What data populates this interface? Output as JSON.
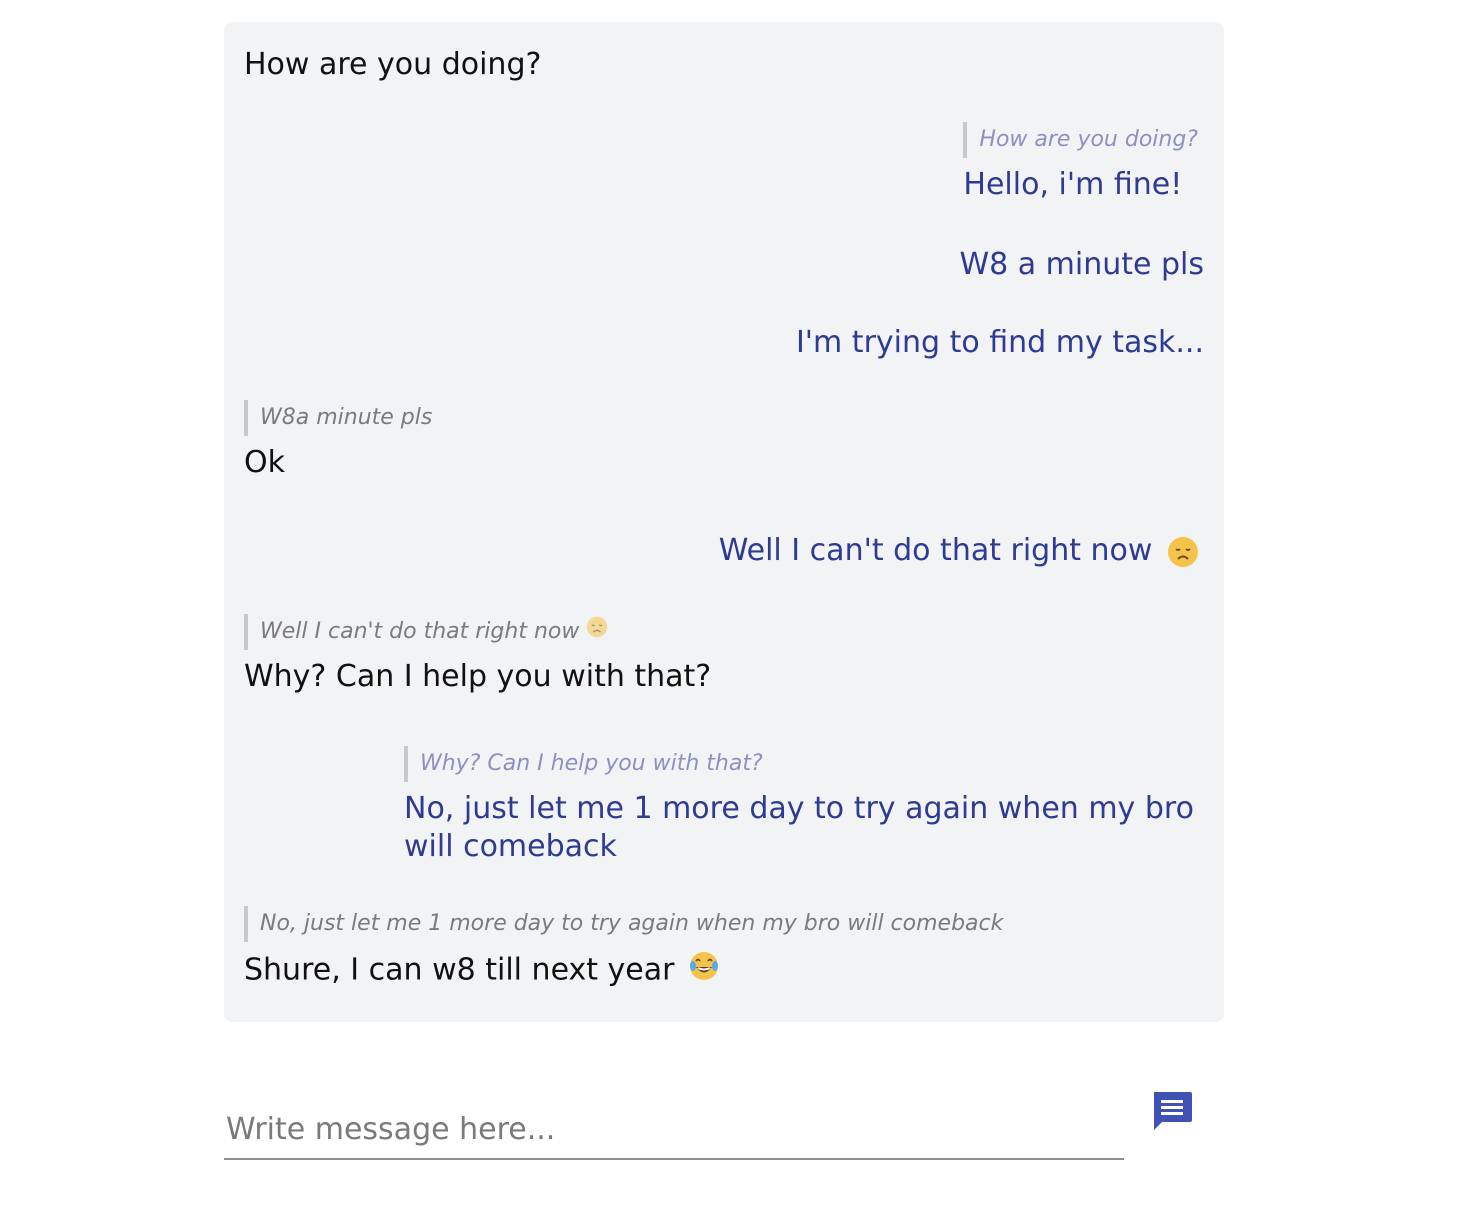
{
  "messages": [
    {
      "side": "left",
      "text": "How are you doing?"
    },
    {
      "side": "right",
      "quote": "How are you doing?",
      "text": "Hello, i'm fine!"
    },
    {
      "side": "right",
      "text": "W8 a minute pls"
    },
    {
      "side": "right",
      "text": "I'm trying to find my task..."
    },
    {
      "side": "left",
      "quote": "W8a minute pls",
      "text": "Ok"
    },
    {
      "side": "right",
      "text": "Well I can't do that right now",
      "emoji": "disappointed-face-icon"
    },
    {
      "side": "left",
      "quote": "Well I can't do that right now",
      "quote_emoji": "disappointed-face-icon",
      "text": "Why? Can I help you with that?"
    },
    {
      "side": "right",
      "quote": "Why? Can I help you with that?",
      "text": "No, just let me 1 more day to try again when my bro will comeback"
    },
    {
      "side": "left",
      "quote": "No, just let me 1 more day to try again when my bro will comeback",
      "text": "Shure, I can w8 till next year",
      "emoji": "tears-of-joy-icon"
    }
  ],
  "composer": {
    "placeholder": "Write message here...",
    "send_icon": "message-icon",
    "send_color": "#3f51b5"
  },
  "colors": {
    "panel_bg": "#f2f3f5",
    "left_text": "#111111",
    "right_text": "#2f3a93"
  }
}
